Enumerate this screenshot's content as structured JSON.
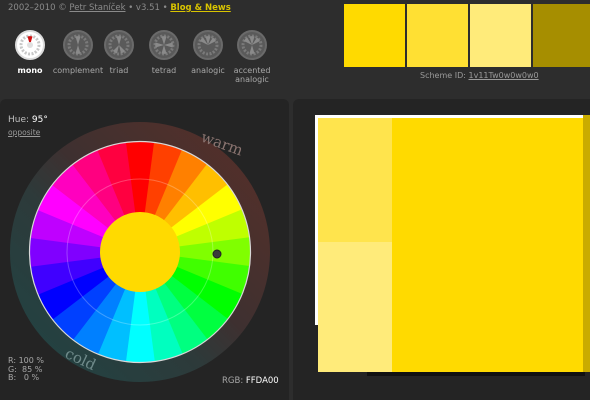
{
  "header": {
    "years": "2002–2010 ©",
    "author": "Petr Staníček",
    "version": "• v3.51 •",
    "blog": "Blog & News"
  },
  "modes": [
    {
      "label": "mono",
      "active": true
    },
    {
      "label": "complement",
      "active": false
    },
    {
      "label": "triad",
      "active": false
    },
    {
      "label": "tetrad",
      "active": false
    },
    {
      "label": "analogic",
      "active": false
    },
    {
      "label": "accented analogic",
      "active": false
    }
  ],
  "top_swatches": [
    "#ffda00",
    "#ffe033",
    "#ffeb7a",
    "#a68e00"
  ],
  "scheme": {
    "label": "Scheme ID:",
    "value": "1v11Tw0w0w0w0"
  },
  "wheel": {
    "hue_label": "Hue:",
    "hue_value": "95°",
    "opposite_label": "opposite",
    "warm_label": "warm",
    "cold_label": "cold",
    "center_color": "#ffda00"
  },
  "rgb": {
    "r_label": "R:",
    "r_value": "100 %",
    "g_label": "G:",
    "g_value": "85 %",
    "b_label": "B:",
    "b_value": "0 %",
    "hex_label": "RGB:",
    "hex_value": "FFDA00"
  },
  "preview_colors": {
    "main": "#ffda00",
    "light": "#ffe44d",
    "lighter": "#ffeb7a",
    "dark": "#c9ab00",
    "border": "#ffffff"
  }
}
